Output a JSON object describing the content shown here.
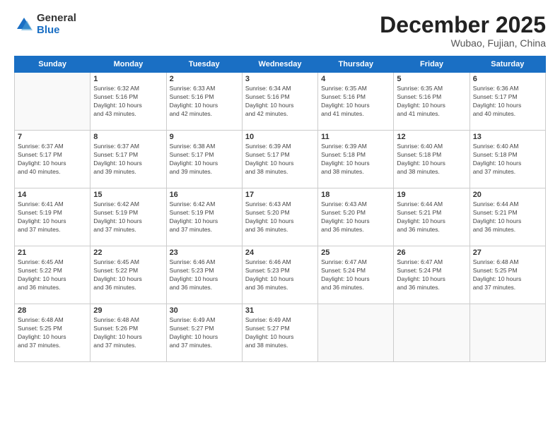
{
  "logo": {
    "general": "General",
    "blue": "Blue"
  },
  "title": "December 2025",
  "subtitle": "Wubao, Fujian, China",
  "weekdays": [
    "Sunday",
    "Monday",
    "Tuesday",
    "Wednesday",
    "Thursday",
    "Friday",
    "Saturday"
  ],
  "weeks": [
    [
      {
        "day": "",
        "info": ""
      },
      {
        "day": "1",
        "info": "Sunrise: 6:32 AM\nSunset: 5:16 PM\nDaylight: 10 hours\nand 43 minutes."
      },
      {
        "day": "2",
        "info": "Sunrise: 6:33 AM\nSunset: 5:16 PM\nDaylight: 10 hours\nand 42 minutes."
      },
      {
        "day": "3",
        "info": "Sunrise: 6:34 AM\nSunset: 5:16 PM\nDaylight: 10 hours\nand 42 minutes."
      },
      {
        "day": "4",
        "info": "Sunrise: 6:35 AM\nSunset: 5:16 PM\nDaylight: 10 hours\nand 41 minutes."
      },
      {
        "day": "5",
        "info": "Sunrise: 6:35 AM\nSunset: 5:16 PM\nDaylight: 10 hours\nand 41 minutes."
      },
      {
        "day": "6",
        "info": "Sunrise: 6:36 AM\nSunset: 5:17 PM\nDaylight: 10 hours\nand 40 minutes."
      }
    ],
    [
      {
        "day": "7",
        "info": "Sunrise: 6:37 AM\nSunset: 5:17 PM\nDaylight: 10 hours\nand 40 minutes."
      },
      {
        "day": "8",
        "info": "Sunrise: 6:37 AM\nSunset: 5:17 PM\nDaylight: 10 hours\nand 39 minutes."
      },
      {
        "day": "9",
        "info": "Sunrise: 6:38 AM\nSunset: 5:17 PM\nDaylight: 10 hours\nand 39 minutes."
      },
      {
        "day": "10",
        "info": "Sunrise: 6:39 AM\nSunset: 5:17 PM\nDaylight: 10 hours\nand 38 minutes."
      },
      {
        "day": "11",
        "info": "Sunrise: 6:39 AM\nSunset: 5:18 PM\nDaylight: 10 hours\nand 38 minutes."
      },
      {
        "day": "12",
        "info": "Sunrise: 6:40 AM\nSunset: 5:18 PM\nDaylight: 10 hours\nand 38 minutes."
      },
      {
        "day": "13",
        "info": "Sunrise: 6:40 AM\nSunset: 5:18 PM\nDaylight: 10 hours\nand 37 minutes."
      }
    ],
    [
      {
        "day": "14",
        "info": "Sunrise: 6:41 AM\nSunset: 5:19 PM\nDaylight: 10 hours\nand 37 minutes."
      },
      {
        "day": "15",
        "info": "Sunrise: 6:42 AM\nSunset: 5:19 PM\nDaylight: 10 hours\nand 37 minutes."
      },
      {
        "day": "16",
        "info": "Sunrise: 6:42 AM\nSunset: 5:19 PM\nDaylight: 10 hours\nand 37 minutes."
      },
      {
        "day": "17",
        "info": "Sunrise: 6:43 AM\nSunset: 5:20 PM\nDaylight: 10 hours\nand 36 minutes."
      },
      {
        "day": "18",
        "info": "Sunrise: 6:43 AM\nSunset: 5:20 PM\nDaylight: 10 hours\nand 36 minutes."
      },
      {
        "day": "19",
        "info": "Sunrise: 6:44 AM\nSunset: 5:21 PM\nDaylight: 10 hours\nand 36 minutes."
      },
      {
        "day": "20",
        "info": "Sunrise: 6:44 AM\nSunset: 5:21 PM\nDaylight: 10 hours\nand 36 minutes."
      }
    ],
    [
      {
        "day": "21",
        "info": "Sunrise: 6:45 AM\nSunset: 5:22 PM\nDaylight: 10 hours\nand 36 minutes."
      },
      {
        "day": "22",
        "info": "Sunrise: 6:45 AM\nSunset: 5:22 PM\nDaylight: 10 hours\nand 36 minutes."
      },
      {
        "day": "23",
        "info": "Sunrise: 6:46 AM\nSunset: 5:23 PM\nDaylight: 10 hours\nand 36 minutes."
      },
      {
        "day": "24",
        "info": "Sunrise: 6:46 AM\nSunset: 5:23 PM\nDaylight: 10 hours\nand 36 minutes."
      },
      {
        "day": "25",
        "info": "Sunrise: 6:47 AM\nSunset: 5:24 PM\nDaylight: 10 hours\nand 36 minutes."
      },
      {
        "day": "26",
        "info": "Sunrise: 6:47 AM\nSunset: 5:24 PM\nDaylight: 10 hours\nand 36 minutes."
      },
      {
        "day": "27",
        "info": "Sunrise: 6:48 AM\nSunset: 5:25 PM\nDaylight: 10 hours\nand 37 minutes."
      }
    ],
    [
      {
        "day": "28",
        "info": "Sunrise: 6:48 AM\nSunset: 5:25 PM\nDaylight: 10 hours\nand 37 minutes."
      },
      {
        "day": "29",
        "info": "Sunrise: 6:48 AM\nSunset: 5:26 PM\nDaylight: 10 hours\nand 37 minutes."
      },
      {
        "day": "30",
        "info": "Sunrise: 6:49 AM\nSunset: 5:27 PM\nDaylight: 10 hours\nand 37 minutes."
      },
      {
        "day": "31",
        "info": "Sunrise: 6:49 AM\nSunset: 5:27 PM\nDaylight: 10 hours\nand 38 minutes."
      },
      {
        "day": "",
        "info": ""
      },
      {
        "day": "",
        "info": ""
      },
      {
        "day": "",
        "info": ""
      }
    ]
  ]
}
